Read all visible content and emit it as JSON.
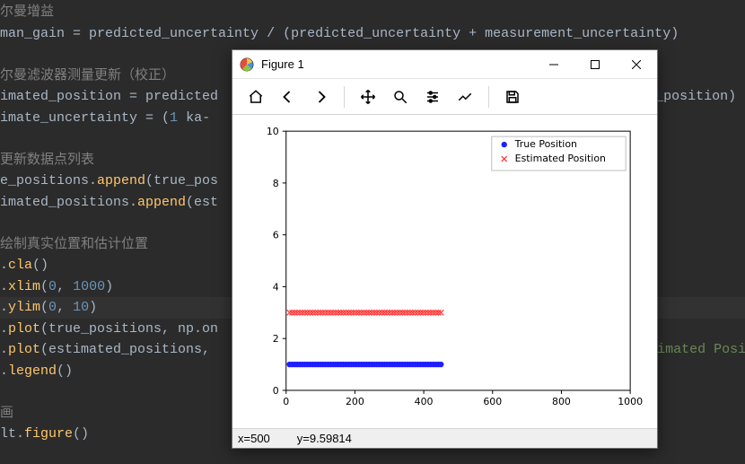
{
  "code": {
    "lines": [
      {
        "k": "cmt",
        "t": "尔曼增益"
      },
      {
        "k": "code",
        "pre": "man_gain ",
        "op1": "= ",
        "id1": "predicted_uncertainty ",
        "op2": "/ (",
        "id2": "predicted_uncertainty ",
        "op3": "+ ",
        "id3": "measurement_uncertainty",
        "op4": ")"
      },
      {
        "k": "blank"
      },
      {
        "k": "cmt",
        "t": "尔曼滤波器测量更新（校正）"
      },
      {
        "k": "code",
        "pre": "imated_position ",
        "op1": "= ",
        "id1": "predicted",
        "tail": "ted_position)"
      },
      {
        "k": "code",
        "pre": "imate_uncertainty ",
        "op1": "= (",
        "num1": "1 ",
        "op2": "- ",
        "id1": "ka"
      },
      {
        "k": "blank"
      },
      {
        "k": "cmt",
        "t": "更新数据点列表"
      },
      {
        "k": "code",
        "pre": "e_positions.",
        "fn": "append",
        "op1": "(true_pos"
      },
      {
        "k": "code",
        "pre": "imated_positions.",
        "fn": "append",
        "op1": "(est"
      },
      {
        "k": "blank"
      },
      {
        "k": "cmt",
        "t": "绘制真实位置和估计位置"
      },
      {
        "k": "code",
        "pre": ".",
        "fn": "cla",
        "op1": "()"
      },
      {
        "k": "code",
        "pre": ".",
        "fn": "xlim",
        "op1": "(",
        "num1": "0",
        "op2": ", ",
        "num2": "1000",
        "op3": ")"
      },
      {
        "k": "hl",
        "pre": ".",
        "fn": "ylim",
        "op1": "(",
        "num1": "0",
        "op2": ", ",
        "num2": "10",
        "op3": ")"
      },
      {
        "k": "code",
        "pre": ".",
        "fn": "plot",
        "op1": "(true_positions, np.on"
      },
      {
        "k": "code",
        "pre": ".",
        "fn": "plot",
        "op1": "(estimated_positions,",
        "hint": "stimated Posit"
      },
      {
        "k": "code",
        "pre": ".",
        "fn": "legend",
        "op1": "()"
      },
      {
        "k": "blank"
      },
      {
        "k": "cmt",
        "t": "画"
      },
      {
        "k": "code",
        "pre": "lt.",
        "fn": "figure",
        "op1": "()"
      }
    ]
  },
  "window": {
    "title": "Figure 1",
    "toolbar": {
      "home": "home",
      "back": "back",
      "forward": "forward",
      "pan": "pan",
      "zoom": "zoom",
      "configure": "configure",
      "edit": "edit",
      "save": "save"
    },
    "status_x": "x=500",
    "status_y": "y=9.59814"
  },
  "chart_data": {
    "type": "scatter",
    "xlim": [
      0,
      1000
    ],
    "ylim": [
      0,
      10
    ],
    "xticks": [
      0,
      200,
      400,
      600,
      800,
      1000
    ],
    "yticks": [
      0,
      2,
      4,
      6,
      8,
      10
    ],
    "series": [
      {
        "name": "True Position",
        "marker": "o",
        "color": "#1f1fff",
        "y": 1,
        "x_start": 10,
        "x_end": 450,
        "count": 60
      },
      {
        "name": "Estimated Position",
        "marker": "x",
        "color": "#ff3b3b",
        "y": 3,
        "x_start": 10,
        "x_end": 450,
        "count": 60
      }
    ],
    "legend_position": "upper-right"
  }
}
